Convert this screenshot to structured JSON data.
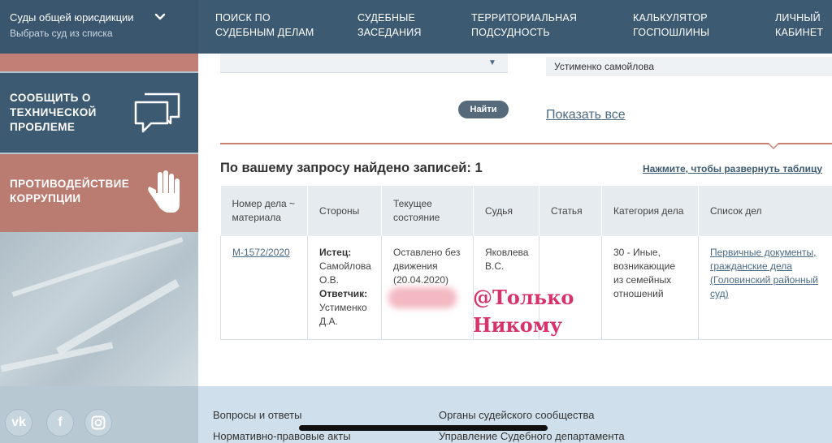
{
  "header": {
    "court_title": "Суды общей юрисдикции",
    "court_subtitle": "Выбрать суд из списка",
    "nav": [
      {
        "line1": "Поиск по",
        "line2": "судебным делам"
      },
      {
        "line1": "Судебные",
        "line2": "заседания"
      },
      {
        "line1": "Территориальная",
        "line2": "подсудность"
      },
      {
        "line1": "Калькулятор",
        "line2": "госпошлины"
      },
      {
        "line1": "Личный",
        "line2": "кабинет"
      }
    ]
  },
  "sidebar": {
    "tech": {
      "line1": "Сообщить о",
      "line2": "технической",
      "line3": "проблеме"
    },
    "anti": {
      "line1": "Противодействие",
      "line2": "коррупции"
    }
  },
  "search": {
    "party_value": "Устименко самойлова",
    "find_label": "Найти",
    "show_all_label": "Показать все"
  },
  "results": {
    "title": "По вашему запросу найдено записей: 1",
    "expand_label": "Нажмите, чтобы развернуть таблицу",
    "columns": [
      "Номер дела ~ материала",
      "Стороны",
      "Текущее состояние",
      "Судья",
      "Статья",
      "Категория дела",
      "Список дел"
    ],
    "row": {
      "case_number": "М-1572/2020",
      "plaintiff_label": "Истец:",
      "plaintiff": "Самойлова О.В.",
      "defendant_label": "Ответчик:",
      "defendant": "Устименко Д.А.",
      "state": "Оставлено без движения (20.04.2020)",
      "judge": "Яковлева В.С.",
      "article": "",
      "category": "30 - Иные, возникающие из семейных отношений",
      "list": "Первичные документы, гражданские дела (Головинский районный суд)"
    }
  },
  "watermark": {
    "line1": "@Только",
    "line2": "Никому"
  },
  "footer": {
    "links": [
      "Вопросы и ответы",
      "Органы судейского сообщества",
      "Нормативно-правовые акты",
      "Управление Судебного департамента"
    ],
    "social": [
      {
        "icon": "vk-icon",
        "glyph": "vk"
      },
      {
        "icon": "facebook-icon",
        "glyph": "f"
      },
      {
        "icon": "instagram-icon",
        "glyph": ""
      }
    ]
  },
  "colors": {
    "header_bg": "#3d5a73",
    "accent_red": "#c97f74",
    "link_blue": "#4a6a85",
    "watermark_pink": "#d8326a"
  }
}
